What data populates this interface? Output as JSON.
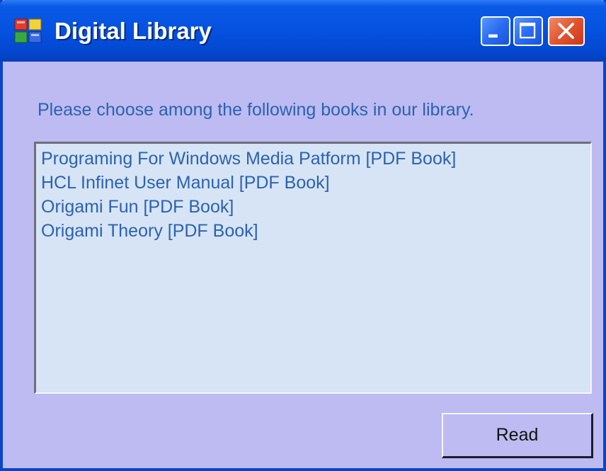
{
  "window": {
    "title": "Digital Library"
  },
  "titlebar_buttons": {
    "minimize_icon": "minimize-icon",
    "maximize_icon": "maximize-icon",
    "close_icon": "close-icon"
  },
  "prompt": "Please choose among the following books in our library.",
  "books": [
    "Programing For Windows Media Patform [PDF Book]",
    "HCL Infinet User Manual [PDF Book]",
    "Origami Fun [PDF Book]",
    "Origami Theory [PDF Book]"
  ],
  "read_button": "Read",
  "colors": {
    "titlebar": "#0551e0",
    "window_background": "#bdbbf2",
    "list_background": "#d6e4f5",
    "text_blue": "#2c62b0",
    "close_button": "#e2542e"
  }
}
